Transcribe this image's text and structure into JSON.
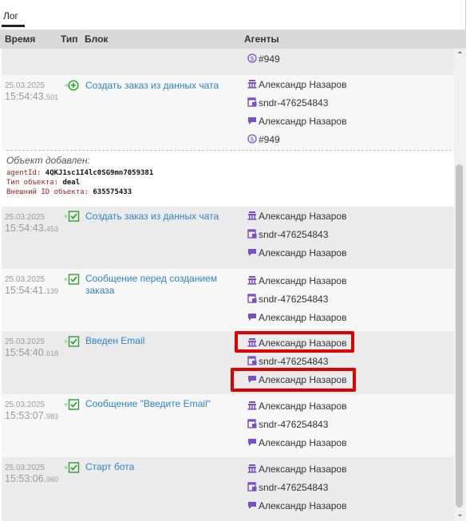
{
  "tabs": {
    "active": "Лог"
  },
  "header": {
    "time": "Время",
    "type": "Тип",
    "block": "Блок",
    "agents": "Агенты"
  },
  "icons": {
    "admin": "building-icon",
    "channel": "chat-window-icon",
    "user": "speech-bubble-icon",
    "deal": "dollar-coin-icon",
    "added": "plus-circle-icon",
    "executed": "checkbox-arrow-icon"
  },
  "colors": {
    "agent_icon": "#7a4fc6",
    "link": "#2a86c6",
    "added": "#22aa22",
    "check": "#2e9e2e",
    "highlight": "#e00000"
  },
  "partial_row": {
    "deal_id": "#949"
  },
  "rows": [
    {
      "date": "25.03.2025",
      "time": "15:54:43.",
      "ms": "501",
      "block": "Создать заказ из данных чата",
      "agent_name": "Александр Назаров",
      "sender": "sndr-476254843",
      "user_name": "Александр Назаров",
      "deal_id": "#949"
    },
    {
      "date": "25.03.2025",
      "time": "15:54:43.",
      "ms": "453",
      "block": "Создать заказ из данных чата",
      "agent_name": "Александр Назаров",
      "sender": "sndr-476254843",
      "user_name": "Александр Назаров"
    },
    {
      "date": "25.03.2025",
      "time": "15:54:41.",
      "ms": "139",
      "block": "Сообщение перед созданием заказа",
      "agent_name": "Александр Назаров",
      "sender": "sndr-476254843",
      "user_name": "Александр Назаров"
    },
    {
      "date": "25.03.2025",
      "time": "15:54:40.",
      "ms": "618",
      "block": "Введен Email",
      "agent_name": "Александр Назаров",
      "sender": "sndr-476254843",
      "user_name": "Александр Назаров"
    },
    {
      "date": "25.03.2025",
      "time": "15:53:07.",
      "ms": "983",
      "block": "Сообщение \"Введите Email\"",
      "agent_name": "Александр Назаров",
      "sender": "sndr-476254843",
      "user_name": "Александр Назаров"
    },
    {
      "date": "25.03.2025",
      "time": "15:53:06.",
      "ms": "960",
      "block": "Старт бота",
      "agent_name": "Александр Назаров",
      "sender": "sndr-476254843",
      "user_name": "Александр Назаров"
    }
  ],
  "detail": {
    "title": "Объект добавлен:",
    "agent_key": "agentId:",
    "agent_val": "4QKJ1sc1I4lc0SG9mn7059381",
    "type_key": "Тип объекта:",
    "type_val": "deal",
    "ext_key": "Внешний ID объекта:",
    "ext_val": "635575433"
  }
}
